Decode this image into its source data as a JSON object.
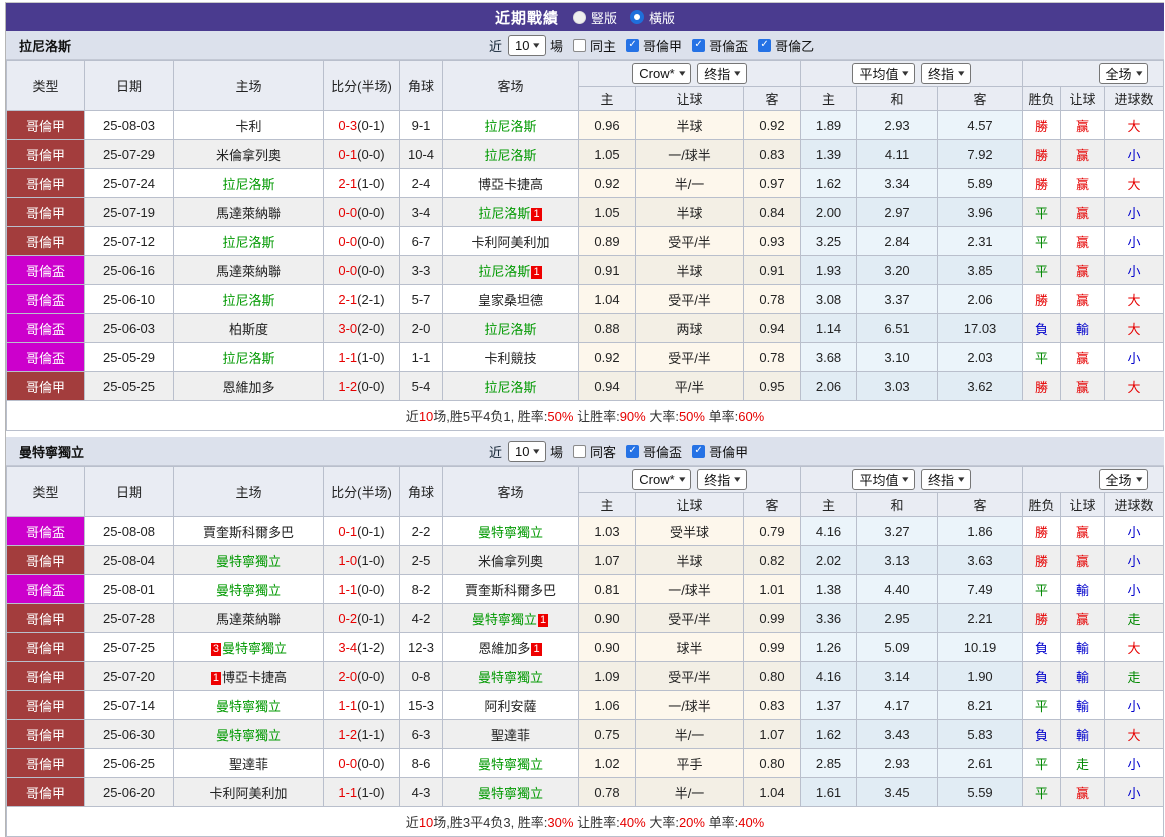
{
  "title_bar": {
    "title": "近期戰績",
    "radios": [
      {
        "label": "豎版",
        "selected": false
      },
      {
        "label": "橫版",
        "selected": true
      }
    ]
  },
  "columns": [
    "类型",
    "日期",
    "主场",
    "比分(半场)",
    "角球",
    "客场",
    "主",
    "让球",
    "客",
    "主",
    "和",
    "客",
    "胜负",
    "让球",
    "进球数"
  ],
  "select_groups": {
    "crow": [
      "Crow*",
      "终指"
    ],
    "avg": [
      "平均值",
      "终指"
    ],
    "scope": [
      "全场"
    ]
  },
  "colors": {
    "header_purple": "#4a3b8f",
    "league": {
      "哥倫甲": "#a33d3d",
      "哥倫盃": "#cc00cc"
    },
    "result": {
      "r": "#e60000",
      "g": "#008800",
      "b": "#0000cc"
    },
    "team_highlight": "#009900",
    "score_ft": "#e60000",
    "red_card_badge": "#ee0000"
  },
  "sections": [
    {
      "team": "拉尼洛斯",
      "filter": {
        "prefix": "近",
        "count": "10",
        "suffix": "場",
        "same": {
          "label": "同主",
          "checked": false
        },
        "leagues": [
          {
            "label": "哥倫甲",
            "checked": true
          },
          {
            "label": "哥倫盃",
            "checked": true
          },
          {
            "label": "哥倫乙",
            "checked": true
          }
        ]
      },
      "rows": [
        {
          "lg": "哥倫甲",
          "date": "25-08-03",
          "home": {
            "name": "卡利"
          },
          "ft": "0-3",
          "ht": "(0-1)",
          "cor": "9-1",
          "away": {
            "name": "拉尼洛斯",
            "hl": true
          },
          "crow": [
            "0.96",
            "半球",
            "0.92"
          ],
          "avg": [
            "1.89",
            "2.93",
            "4.57"
          ],
          "res": [
            [
              "勝",
              "r"
            ],
            [
              "赢",
              "r"
            ],
            [
              "大",
              "r"
            ]
          ]
        },
        {
          "lg": "哥倫甲",
          "date": "25-07-29",
          "home": {
            "name": "米倫拿列奧"
          },
          "ft": "0-1",
          "ht": "(0-0)",
          "cor": "10-4",
          "away": {
            "name": "拉尼洛斯",
            "hl": true
          },
          "crow": [
            "1.05",
            "一/球半",
            "0.83"
          ],
          "avg": [
            "1.39",
            "4.11",
            "7.92"
          ],
          "res": [
            [
              "勝",
              "r"
            ],
            [
              "赢",
              "r"
            ],
            [
              "小",
              "b"
            ]
          ]
        },
        {
          "lg": "哥倫甲",
          "date": "25-07-24",
          "home": {
            "name": "拉尼洛斯",
            "hl": true
          },
          "ft": "2-1",
          "ht": "(1-0)",
          "cor": "2-4",
          "away": {
            "name": "博亞卡捷高"
          },
          "crow": [
            "0.92",
            "半/一",
            "0.97"
          ],
          "avg": [
            "1.62",
            "3.34",
            "5.89"
          ],
          "res": [
            [
              "勝",
              "r"
            ],
            [
              "赢",
              "r"
            ],
            [
              "大",
              "r"
            ]
          ]
        },
        {
          "lg": "哥倫甲",
          "date": "25-07-19",
          "home": {
            "name": "馬達萊納聯"
          },
          "ft": "0-0",
          "ht": "(0-0)",
          "cor": "3-4",
          "away": {
            "name": "拉尼洛斯",
            "hl": true,
            "suf": "1"
          },
          "crow": [
            "1.05",
            "半球",
            "0.84"
          ],
          "avg": [
            "2.00",
            "2.97",
            "3.96"
          ],
          "res": [
            [
              "平",
              "g"
            ],
            [
              "赢",
              "r"
            ],
            [
              "小",
              "b"
            ]
          ]
        },
        {
          "lg": "哥倫甲",
          "date": "25-07-12",
          "home": {
            "name": "拉尼洛斯",
            "hl": true
          },
          "ft": "0-0",
          "ht": "(0-0)",
          "cor": "6-7",
          "away": {
            "name": "卡利阿美利加"
          },
          "crow": [
            "0.89",
            "受平/半",
            "0.93"
          ],
          "avg": [
            "3.25",
            "2.84",
            "2.31"
          ],
          "res": [
            [
              "平",
              "g"
            ],
            [
              "赢",
              "r"
            ],
            [
              "小",
              "b"
            ]
          ]
        },
        {
          "lg": "哥倫盃",
          "date": "25-06-16",
          "home": {
            "name": "馬達萊納聯"
          },
          "ft": "0-0",
          "ht": "(0-0)",
          "cor": "3-3",
          "away": {
            "name": "拉尼洛斯",
            "hl": true,
            "suf": "1"
          },
          "crow": [
            "0.91",
            "半球",
            "0.91"
          ],
          "avg": [
            "1.93",
            "3.20",
            "3.85"
          ],
          "res": [
            [
              "平",
              "g"
            ],
            [
              "赢",
              "r"
            ],
            [
              "小",
              "b"
            ]
          ]
        },
        {
          "lg": "哥倫盃",
          "date": "25-06-10",
          "home": {
            "name": "拉尼洛斯",
            "hl": true
          },
          "ft": "2-1",
          "ht": "(2-1)",
          "cor": "5-7",
          "away": {
            "name": "皇家桑坦德"
          },
          "crow": [
            "1.04",
            "受平/半",
            "0.78"
          ],
          "avg": [
            "3.08",
            "3.37",
            "2.06"
          ],
          "res": [
            [
              "勝",
              "r"
            ],
            [
              "赢",
              "r"
            ],
            [
              "大",
              "r"
            ]
          ]
        },
        {
          "lg": "哥倫盃",
          "date": "25-06-03",
          "home": {
            "name": "柏斯度"
          },
          "ft": "3-0",
          "ht": "(2-0)",
          "cor": "2-0",
          "away": {
            "name": "拉尼洛斯",
            "hl": true
          },
          "crow": [
            "0.88",
            "两球",
            "0.94"
          ],
          "avg": [
            "1.14",
            "6.51",
            "17.03"
          ],
          "res": [
            [
              "負",
              "b"
            ],
            [
              "輸",
              "b"
            ],
            [
              "大",
              "r"
            ]
          ]
        },
        {
          "lg": "哥倫盃",
          "date": "25-05-29",
          "home": {
            "name": "拉尼洛斯",
            "hl": true
          },
          "ft": "1-1",
          "ht": "(1-0)",
          "cor": "1-1",
          "away": {
            "name": "卡利競技"
          },
          "crow": [
            "0.92",
            "受平/半",
            "0.78"
          ],
          "avg": [
            "3.68",
            "3.10",
            "2.03"
          ],
          "res": [
            [
              "平",
              "g"
            ],
            [
              "赢",
              "r"
            ],
            [
              "小",
              "b"
            ]
          ]
        },
        {
          "lg": "哥倫甲",
          "date": "25-05-25",
          "home": {
            "name": "恩維加多"
          },
          "ft": "1-2",
          "ht": "(0-0)",
          "cor": "5-4",
          "away": {
            "name": "拉尼洛斯",
            "hl": true
          },
          "crow": [
            "0.94",
            "平/半",
            "0.95"
          ],
          "avg": [
            "2.06",
            "3.03",
            "3.62"
          ],
          "res": [
            [
              "勝",
              "r"
            ],
            [
              "赢",
              "r"
            ],
            [
              "大",
              "r"
            ]
          ]
        }
      ],
      "footer": [
        [
          "近",
          "k"
        ],
        [
          "10",
          "r"
        ],
        [
          "场,胜5平4负1, 胜率:",
          "k"
        ],
        [
          "50%",
          "r"
        ],
        [
          " 让胜率:",
          "k"
        ],
        [
          "90%",
          "r"
        ],
        [
          " 大率:",
          "k"
        ],
        [
          "50%",
          "r"
        ],
        [
          " 单率:",
          "k"
        ],
        [
          "60%",
          "r"
        ]
      ]
    },
    {
      "team": "曼特寧獨立",
      "filter": {
        "prefix": "近",
        "count": "10",
        "suffix": "場",
        "same": {
          "label": "同客",
          "checked": false
        },
        "leagues": [
          {
            "label": "哥倫盃",
            "checked": true
          },
          {
            "label": "哥倫甲",
            "checked": true
          }
        ]
      },
      "rows": [
        {
          "lg": "哥倫盃",
          "date": "25-08-08",
          "home": {
            "name": "賈奎斯科爾多巴"
          },
          "ft": "0-1",
          "ht": "(0-1)",
          "cor": "2-2",
          "away": {
            "name": "曼特寧獨立",
            "hl": true
          },
          "crow": [
            "1.03",
            "受半球",
            "0.79"
          ],
          "avg": [
            "4.16",
            "3.27",
            "1.86"
          ],
          "res": [
            [
              "勝",
              "r"
            ],
            [
              "赢",
              "r"
            ],
            [
              "小",
              "b"
            ]
          ]
        },
        {
          "lg": "哥倫甲",
          "date": "25-08-04",
          "home": {
            "name": "曼特寧獨立",
            "hl": true
          },
          "ft": "1-0",
          "ht": "(1-0)",
          "cor": "2-5",
          "away": {
            "name": "米倫拿列奧"
          },
          "crow": [
            "1.07",
            "半球",
            "0.82"
          ],
          "avg": [
            "2.02",
            "3.13",
            "3.63"
          ],
          "res": [
            [
              "勝",
              "r"
            ],
            [
              "赢",
              "r"
            ],
            [
              "小",
              "b"
            ]
          ]
        },
        {
          "lg": "哥倫盃",
          "date": "25-08-01",
          "home": {
            "name": "曼特寧獨立",
            "hl": true
          },
          "ft": "1-1",
          "ht": "(0-0)",
          "cor": "8-2",
          "away": {
            "name": "賈奎斯科爾多巴"
          },
          "crow": [
            "0.81",
            "一/球半",
            "1.01"
          ],
          "avg": [
            "1.38",
            "4.40",
            "7.49"
          ],
          "res": [
            [
              "平",
              "g"
            ],
            [
              "輸",
              "b"
            ],
            [
              "小",
              "b"
            ]
          ]
        },
        {
          "lg": "哥倫甲",
          "date": "25-07-28",
          "home": {
            "name": "馬達萊納聯"
          },
          "ft": "0-2",
          "ht": "(0-1)",
          "cor": "4-2",
          "away": {
            "name": "曼特寧獨立",
            "hl": true,
            "suf": "1"
          },
          "crow": [
            "0.90",
            "受平/半",
            "0.99"
          ],
          "avg": [
            "3.36",
            "2.95",
            "2.21"
          ],
          "res": [
            [
              "勝",
              "r"
            ],
            [
              "赢",
              "r"
            ],
            [
              "走",
              "g"
            ]
          ]
        },
        {
          "lg": "哥倫甲",
          "date": "25-07-25",
          "home": {
            "name": "曼特寧獨立",
            "hl": true,
            "pre": "3"
          },
          "ft": "3-4",
          "ht": "(1-2)",
          "cor": "12-3",
          "away": {
            "name": "恩維加多",
            "suf": "1"
          },
          "crow": [
            "0.90",
            "球半",
            "0.99"
          ],
          "avg": [
            "1.26",
            "5.09",
            "10.19"
          ],
          "res": [
            [
              "負",
              "b"
            ],
            [
              "輸",
              "b"
            ],
            [
              "大",
              "r"
            ]
          ]
        },
        {
          "lg": "哥倫甲",
          "date": "25-07-20",
          "home": {
            "name": "博亞卡捷高",
            "pre": "1"
          },
          "ft": "2-0",
          "ht": "(0-0)",
          "cor": "0-8",
          "away": {
            "name": "曼特寧獨立",
            "hl": true
          },
          "crow": [
            "1.09",
            "受平/半",
            "0.80"
          ],
          "avg": [
            "4.16",
            "3.14",
            "1.90"
          ],
          "res": [
            [
              "負",
              "b"
            ],
            [
              "輸",
              "b"
            ],
            [
              "走",
              "g"
            ]
          ]
        },
        {
          "lg": "哥倫甲",
          "date": "25-07-14",
          "home": {
            "name": "曼特寧獨立",
            "hl": true
          },
          "ft": "1-1",
          "ht": "(0-1)",
          "cor": "15-3",
          "away": {
            "name": "阿利安薩"
          },
          "crow": [
            "1.06",
            "一/球半",
            "0.83"
          ],
          "avg": [
            "1.37",
            "4.17",
            "8.21"
          ],
          "res": [
            [
              "平",
              "g"
            ],
            [
              "輸",
              "b"
            ],
            [
              "小",
              "b"
            ]
          ]
        },
        {
          "lg": "哥倫甲",
          "date": "25-06-30",
          "home": {
            "name": "曼特寧獨立",
            "hl": true
          },
          "ft": "1-2",
          "ht": "(1-1)",
          "cor": "6-3",
          "away": {
            "name": "聖達菲"
          },
          "crow": [
            "0.75",
            "半/一",
            "1.07"
          ],
          "avg": [
            "1.62",
            "3.43",
            "5.83"
          ],
          "res": [
            [
              "負",
              "b"
            ],
            [
              "輸",
              "b"
            ],
            [
              "大",
              "r"
            ]
          ]
        },
        {
          "lg": "哥倫甲",
          "date": "25-06-25",
          "home": {
            "name": "聖達菲"
          },
          "ft": "0-0",
          "ht": "(0-0)",
          "cor": "8-6",
          "away": {
            "name": "曼特寧獨立",
            "hl": true
          },
          "crow": [
            "1.02",
            "平手",
            "0.80"
          ],
          "avg": [
            "2.85",
            "2.93",
            "2.61"
          ],
          "res": [
            [
              "平",
              "g"
            ],
            [
              "走",
              "g"
            ],
            [
              "小",
              "b"
            ]
          ]
        },
        {
          "lg": "哥倫甲",
          "date": "25-06-20",
          "home": {
            "name": "卡利阿美利加"
          },
          "ft": "1-1",
          "ht": "(1-0)",
          "cor": "4-3",
          "away": {
            "name": "曼特寧獨立",
            "hl": true
          },
          "crow": [
            "0.78",
            "半/一",
            "1.04"
          ],
          "avg": [
            "1.61",
            "3.45",
            "5.59"
          ],
          "res": [
            [
              "平",
              "g"
            ],
            [
              "赢",
              "r"
            ],
            [
              "小",
              "b"
            ]
          ]
        }
      ],
      "footer": [
        [
          "近",
          "k"
        ],
        [
          "10",
          "r"
        ],
        [
          "场,胜3平4负3, 胜率:",
          "k"
        ],
        [
          "30%",
          "r"
        ],
        [
          " 让胜率:",
          "k"
        ],
        [
          "40%",
          "r"
        ],
        [
          " 大率:",
          "k"
        ],
        [
          "20%",
          "r"
        ],
        [
          " 单率:",
          "k"
        ],
        [
          "40%",
          "r"
        ]
      ]
    }
  ]
}
